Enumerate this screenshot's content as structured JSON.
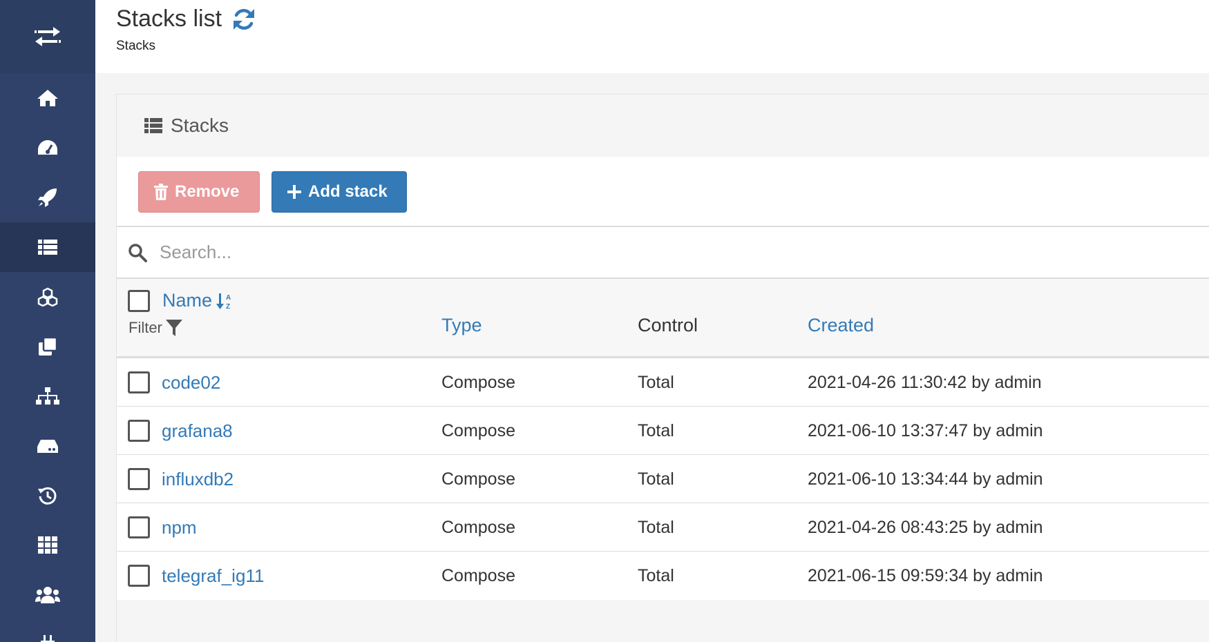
{
  "header": {
    "title": "Stacks list",
    "breadcrumb": "Stacks"
  },
  "sidebar": {
    "items": [
      {
        "icon": "home-icon",
        "active": false
      },
      {
        "icon": "dashboard-icon",
        "active": false
      },
      {
        "icon": "rocket-icon",
        "active": false
      },
      {
        "icon": "list-icon",
        "active": true
      },
      {
        "icon": "cubes-icon",
        "active": false
      },
      {
        "icon": "clone-icon",
        "active": false
      },
      {
        "icon": "sitemap-icon",
        "active": false
      },
      {
        "icon": "hdd-icon",
        "active": false
      },
      {
        "icon": "history-icon",
        "active": false
      },
      {
        "icon": "th-icon",
        "active": false
      },
      {
        "icon": "users-icon",
        "active": false
      },
      {
        "icon": "plug-icon",
        "active": false
      }
    ]
  },
  "widget": {
    "title": "Stacks",
    "remove_label": "Remove",
    "add_label": "Add stack",
    "search_placeholder": "Search..."
  },
  "table": {
    "headers": {
      "name": "Name",
      "filter": "Filter",
      "type": "Type",
      "control": "Control",
      "created": "Created"
    },
    "rows": [
      {
        "name": "code02",
        "type": "Compose",
        "control": "Total",
        "created": "2021-04-26 11:30:42 by admin"
      },
      {
        "name": "grafana8",
        "type": "Compose",
        "control": "Total",
        "created": "2021-06-10 13:37:47 by admin"
      },
      {
        "name": "influxdb2",
        "type": "Compose",
        "control": "Total",
        "created": "2021-06-10 13:34:44 by admin"
      },
      {
        "name": "npm",
        "type": "Compose",
        "control": "Total",
        "created": "2021-04-26 08:43:25 by admin"
      },
      {
        "name": "telegraf_ig11",
        "type": "Compose",
        "control": "Total",
        "created": "2021-06-15 09:59:34 by admin"
      }
    ]
  },
  "colors": {
    "sidebar": "#30426a",
    "accent": "#337ab7",
    "danger_disabled": "#ea9a9a"
  }
}
